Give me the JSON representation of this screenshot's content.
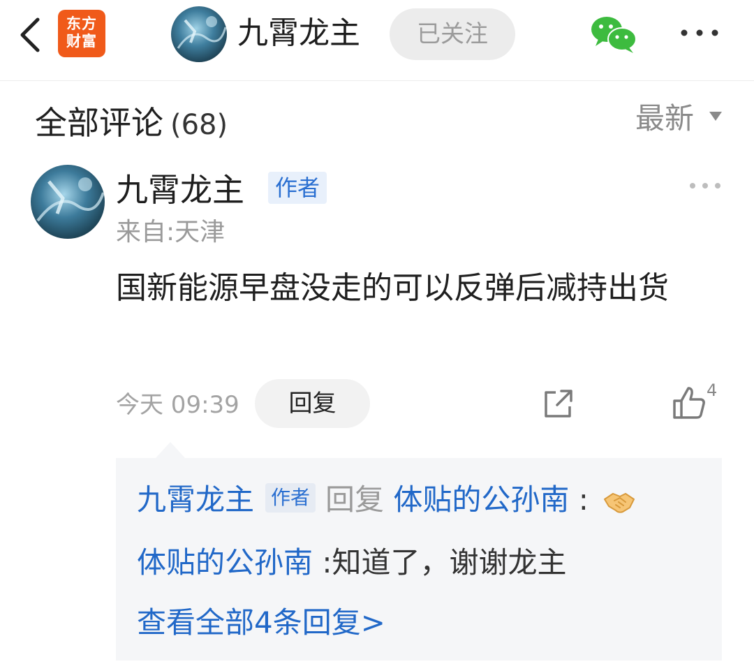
{
  "header": {
    "logo_line1": "东方",
    "logo_line2": "财富",
    "author_name": "九霄龙主",
    "follow_label": "已关注"
  },
  "section": {
    "title": "全部评论",
    "count": "(68)",
    "sort_label": "最新"
  },
  "comment": {
    "author": "九霄龙主",
    "author_tag": "作者",
    "location": "来自:天津",
    "text": "国新能源早盘没走的可以反弹后减持出货",
    "time": "今天 09:39",
    "reply_label": "回复",
    "like_count": "4"
  },
  "replies": {
    "line1": {
      "user": "九霄龙主",
      "tag": "作者",
      "verb": "回复",
      "target": "体贴的公孙南",
      "colon": ":"
    },
    "line2": {
      "user": "体贴的公孙南",
      "text": ":知道了，谢谢龙主"
    },
    "view_all": "查看全部4条回复>"
  },
  "colors": {
    "brand_orange": "#f05a1a",
    "link_blue": "#2168c8",
    "tag_blue": "#2a6fd1"
  },
  "icons": [
    "back-arrow-icon",
    "wechat-icon",
    "more-dots-icon",
    "sort-caret-icon",
    "share-icon",
    "like-icon",
    "handshake-icon"
  ]
}
